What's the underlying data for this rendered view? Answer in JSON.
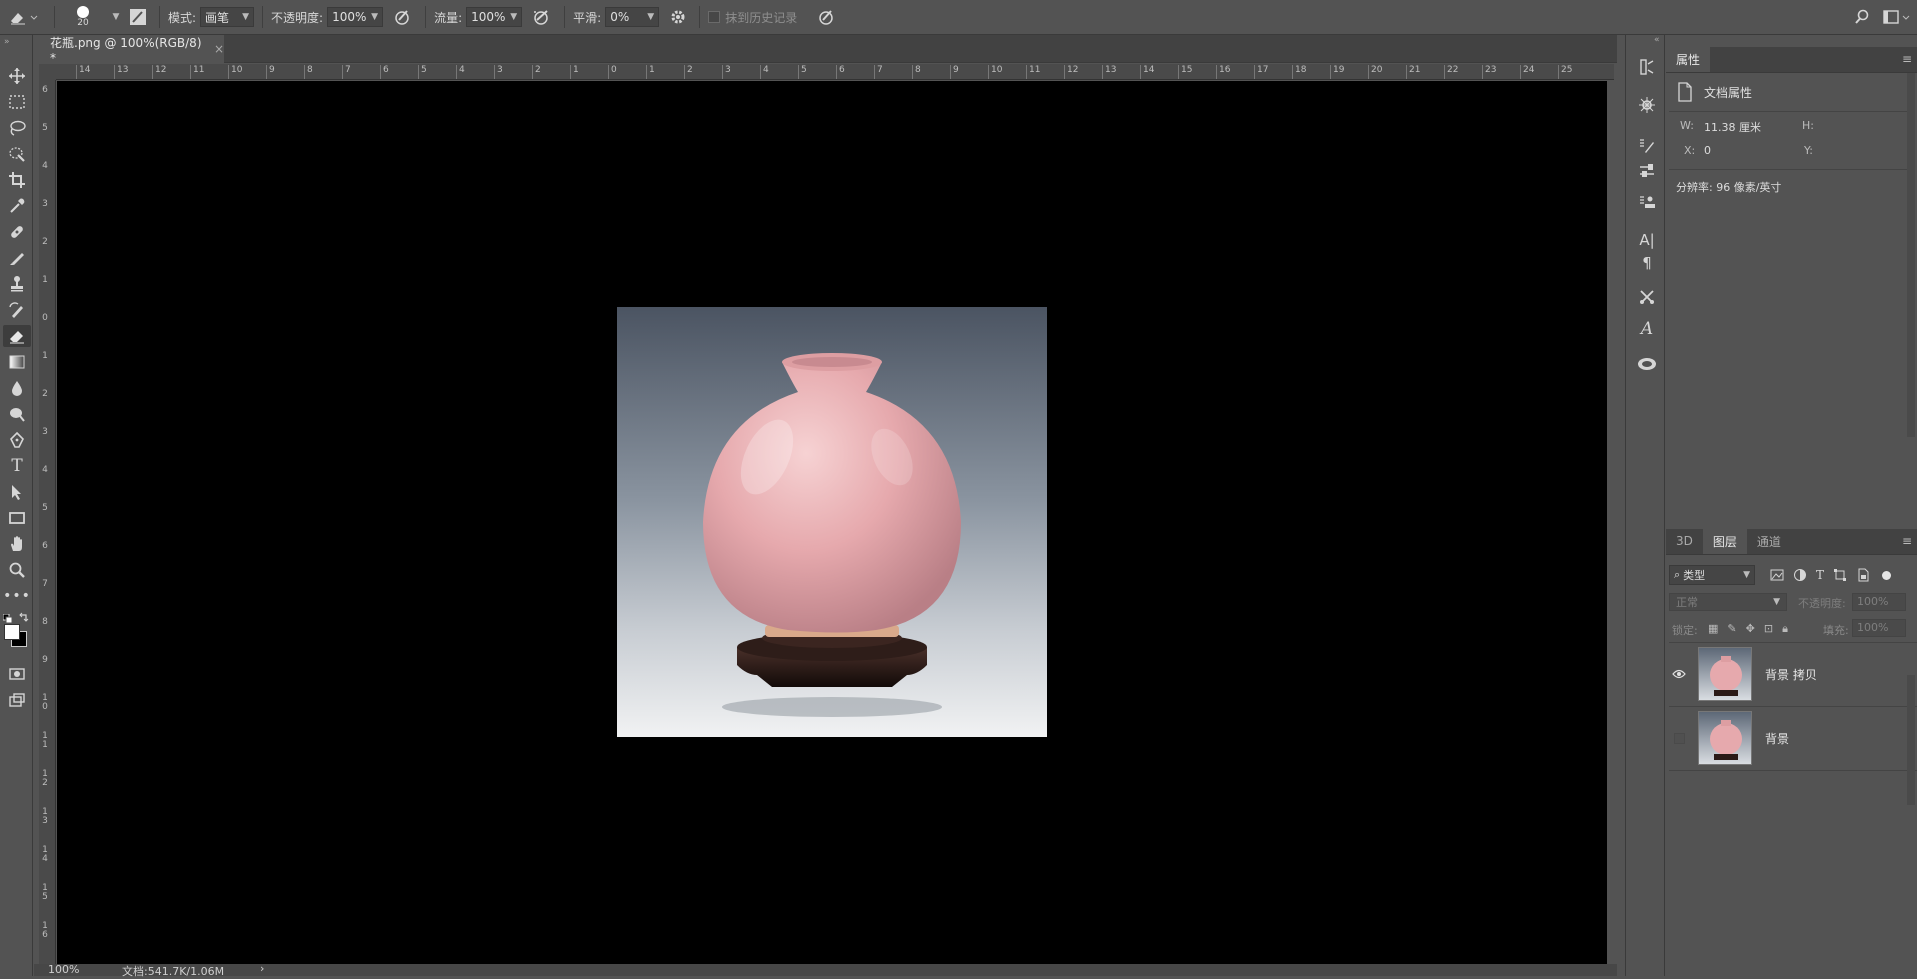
{
  "options_bar": {
    "brush_size": "20",
    "mode_label": "模式:",
    "mode_value": "画笔",
    "opacity_label": "不透明度:",
    "opacity_value": "100%",
    "flow_label": "流量:",
    "flow_value": "100%",
    "smoothing_label": "平滑:",
    "smoothing_value": "0%",
    "history_label": "抹到历史记录"
  },
  "document": {
    "tab_title": "花瓶.png @ 100%(RGB/8) *",
    "close_glyph": "×"
  },
  "rulers": {
    "horizontal": [
      "14",
      "13",
      "12",
      "11",
      "10",
      "9",
      "8",
      "7",
      "6",
      "5",
      "4",
      "3",
      "2",
      "1",
      "0",
      "1",
      "2",
      "3",
      "4",
      "5",
      "6",
      "7",
      "8",
      "9",
      "10",
      "11",
      "12",
      "13",
      "14",
      "15",
      "16",
      "17",
      "18",
      "19",
      "20",
      "21",
      "22",
      "23",
      "24",
      "25"
    ],
    "vertical": [
      "6",
      "5",
      "4",
      "3",
      "2",
      "1",
      "0",
      "1",
      "2",
      "3",
      "4",
      "5",
      "6",
      "7",
      "8",
      "9",
      "10",
      "11",
      "12",
      "13",
      "14",
      "15",
      "16"
    ]
  },
  "status_bar": {
    "zoom": "100%",
    "doc_info": "文档:541.7K/1.06M",
    "arrow": "›"
  },
  "properties_panel": {
    "tab": "属性",
    "section_title": "文档属性",
    "w_label": "W:",
    "w_value": "11.38 厘米",
    "h_label": "H:",
    "x_label": "X:",
    "x_value": "0",
    "y_label": "Y:",
    "resolution": "分辨率: 96 像素/英寸"
  },
  "layers_panel": {
    "tabs": [
      "3D",
      "图层",
      "通道"
    ],
    "filter_label": "类型",
    "blend_mode": "正常",
    "opacity_label": "不透明度:",
    "opacity_value": "100%",
    "lock_label": "锁定:",
    "fill_label": "填充:",
    "fill_value": "100%",
    "layers": [
      {
        "name": "背景 拷贝",
        "visible": true
      },
      {
        "name": "背景",
        "visible": false
      }
    ]
  },
  "colors": {
    "ui_dark": "#535353",
    "canvas_bg": "#000000",
    "vase_pink": "#e6a9ad",
    "stand": "#2a1a17"
  }
}
